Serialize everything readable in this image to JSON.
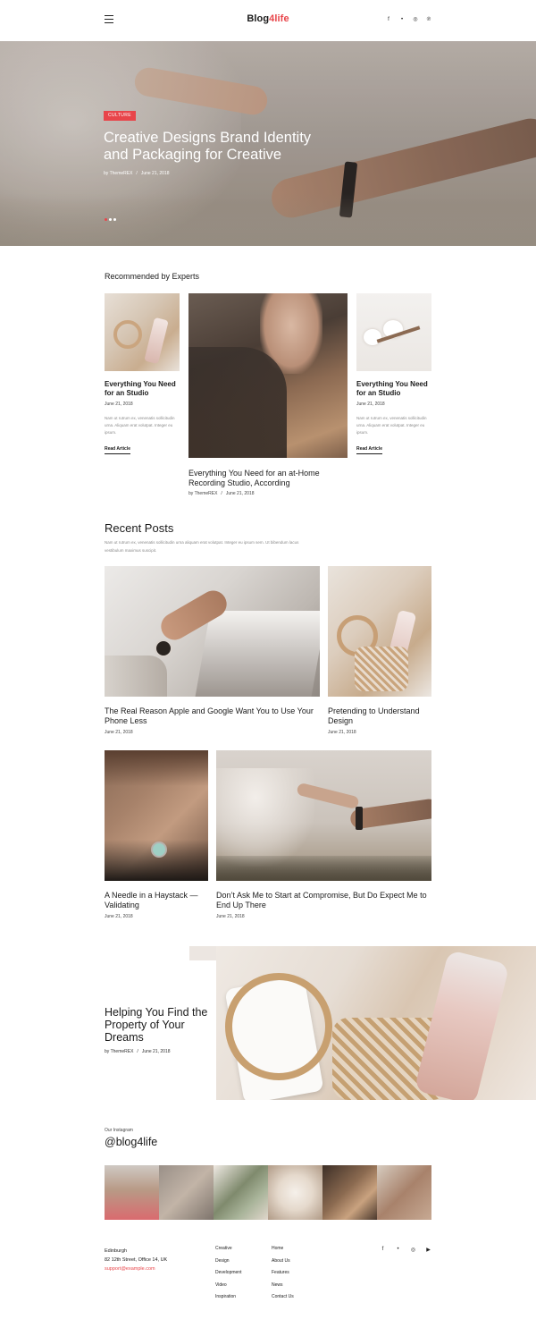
{
  "header": {
    "logo_part1": "Blog",
    "logo_part2": "4life",
    "menu_icon": "hamburger-icon",
    "social": [
      "f",
      "•",
      "◎",
      "℗"
    ]
  },
  "hero": {
    "tag": "Culture",
    "title": "Creative Designs Brand Identity and Packaging for Creative",
    "author": "by ThemeREX",
    "date": "June 21, 2018",
    "slides_total": 3,
    "active_slide": 1
  },
  "recommended": {
    "title": "Recommended by Experts",
    "left": {
      "title": "Everything You Need for an Studio",
      "date": "June 21, 2018",
      "excerpt": "Nam ut rutrum ex, venenatis sollicitudin urna. Aliquam erat volutpat. Integer eu ipsum.",
      "link": "Read Article"
    },
    "center": {
      "title": "Everything You Need for an at-Home Recording Studio, According",
      "author": "by ThemeREX",
      "date": "June 21, 2018"
    },
    "right": {
      "title": "Everything You Need for an Studio",
      "date": "June 21, 2018",
      "excerpt": "Nam ut rutrum ex, venenatis sollicitudin urna. Aliquam erat volutpat. Integer eu ipsum.",
      "link": "Read Article"
    }
  },
  "recent": {
    "title": "Recent Posts",
    "intro": "Nam ut rutrum ex, venenatis sollicitudin urna aliquam erat volutpat. Integer eu ipsum sem. Ut bibendum lacus vestibulum maximus suscipit.",
    "posts": [
      {
        "title": "The Real Reason Apple and Google Want You to Use Your Phone Less",
        "date": "June 21, 2018"
      },
      {
        "title": "Pretending to Understand Design",
        "date": "June 21, 2018"
      },
      {
        "title": "A Needle in a Haystack — Validating",
        "date": "June 21, 2018"
      },
      {
        "title": "Don’t Ask Me to Start at Compromise, But Do Expect Me to End Up There",
        "date": "June 21, 2018"
      }
    ]
  },
  "promo": {
    "title": "Helping You Find the Property of Your Dreams",
    "author": "by ThemeREX",
    "date": "June 21, 2018"
  },
  "instagram": {
    "label": "Our Instagram",
    "handle": "@blog4life"
  },
  "footer": {
    "city": "Edinburgh",
    "street": "82 12th Street, Office 14, UK",
    "email": "support@example.com",
    "col1": [
      "Creative",
      "Design",
      "Development",
      "Video",
      "Inspiration"
    ],
    "col2": [
      "Home",
      "About Us",
      "Features",
      "News",
      "Contact Us"
    ],
    "social": [
      "f",
      "•",
      "◎",
      "▶"
    ]
  },
  "colors": {
    "accent": "#e8454a",
    "text": "#1a1a1a",
    "muted": "#8a8a8a"
  }
}
